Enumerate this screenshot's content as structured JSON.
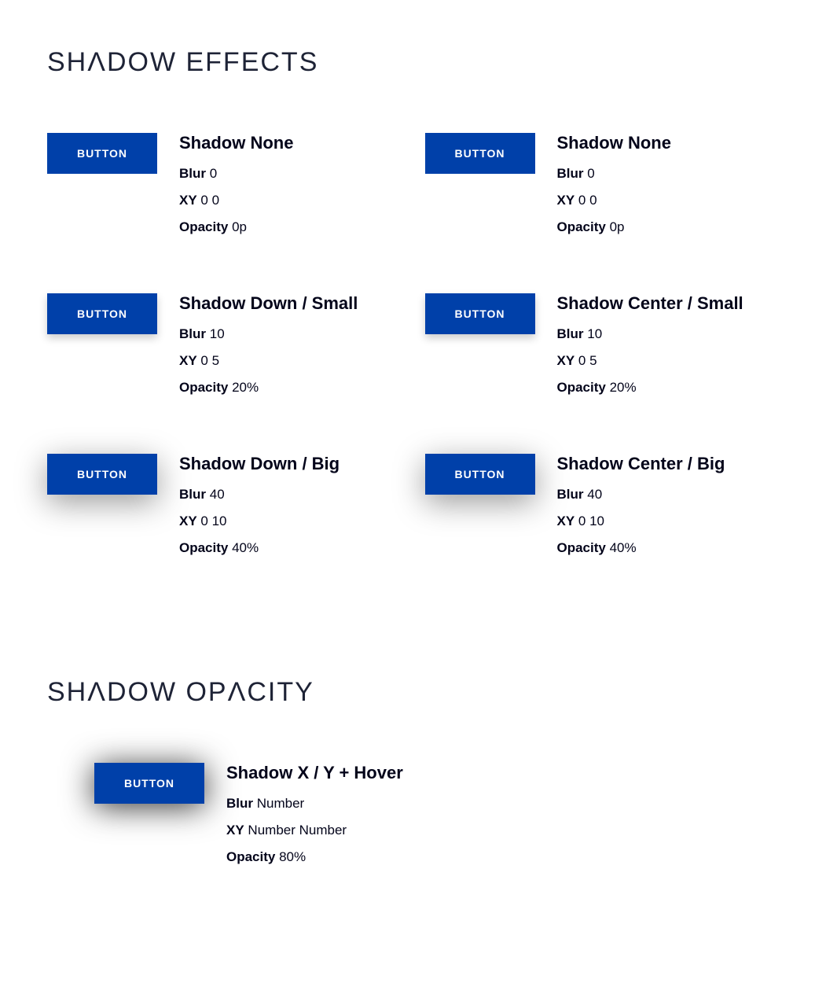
{
  "sections": {
    "effects": {
      "title_html": "SHΛDOW EFFECTS"
    },
    "opacity": {
      "title_html": "SHΛDOW OPΛCITY"
    }
  },
  "button_label": "BUTTON",
  "labels": {
    "blur": "Blur",
    "xy": "XY",
    "opacity": "Opacity"
  },
  "examples": [
    {
      "id": "none-1",
      "shadow_class": "shadow-none",
      "title": "Shadow None",
      "blur": "0",
      "xy": "0 0",
      "opacity": "0p"
    },
    {
      "id": "none-2",
      "shadow_class": "shadow-none",
      "title": "Shadow None",
      "blur": "0",
      "xy": "0 0",
      "opacity": "0p"
    },
    {
      "id": "down-small",
      "shadow_class": "shadow-down-small",
      "title": "Shadow Down / Small",
      "blur": "10",
      "xy": "0 5",
      "opacity": "20%"
    },
    {
      "id": "center-small",
      "shadow_class": "shadow-center-small",
      "title": "Shadow Center / Small",
      "blur": "10",
      "xy": "0 5",
      "opacity": "20%"
    },
    {
      "id": "down-big",
      "shadow_class": "shadow-down-big",
      "title": "Shadow Down / Big",
      "blur": "40",
      "xy": "0 10",
      "opacity": "40%"
    },
    {
      "id": "center-big",
      "shadow_class": "shadow-center-big",
      "title": "Shadow Center / Big",
      "blur": "40",
      "xy": "0 10",
      "opacity": "40%"
    }
  ],
  "opacity_example": {
    "shadow_class": "shadow-hover",
    "title": "Shadow X / Y + Hover",
    "blur": "Number",
    "xy": "Number Number",
    "opacity": "80%"
  }
}
